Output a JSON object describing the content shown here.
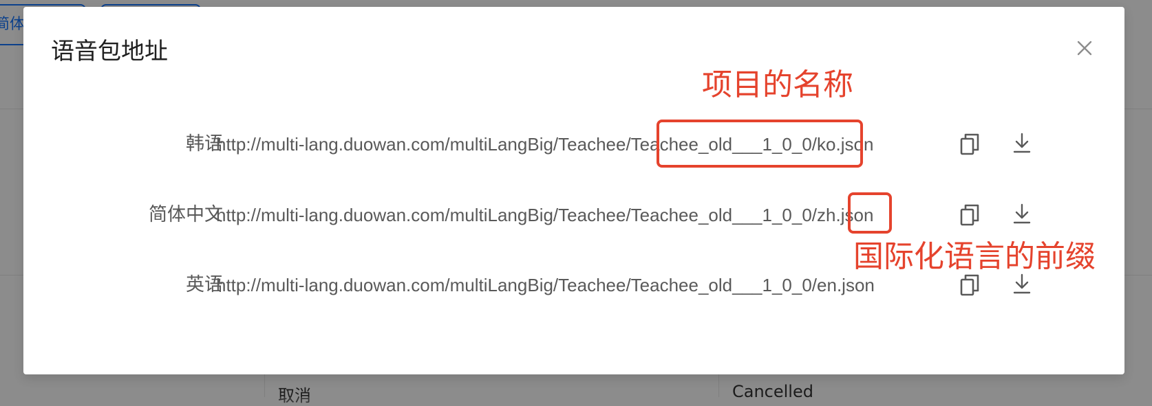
{
  "background": {
    "button_1_label": "简体",
    "table_cell_left": "取消",
    "table_cell_right": "Cancelled"
  },
  "modal": {
    "title": "语音包地址",
    "close_icon": "close-icon",
    "rows": [
      {
        "label": "韩语",
        "url": "http://multi-lang.duowan.com/multiLangBig/Teachee/Teachee_old___1_0_0/ko.json",
        "copy_icon": "copy-icon",
        "download_icon": "download-icon"
      },
      {
        "label": "简体中文",
        "url": "http://multi-lang.duowan.com/multiLangBig/Teachee/Teachee_old___1_0_0/zh.json",
        "copy_icon": "copy-icon",
        "download_icon": "download-icon"
      },
      {
        "label": "英语",
        "url": "http://multi-lang.duowan.com/multiLangBig/Teachee/Teachee_old___1_0_0/en.json",
        "copy_icon": "copy-icon",
        "download_icon": "download-icon"
      }
    ]
  },
  "annotations": {
    "project_name_note": "项目的名称",
    "prefix_note": "国际化语言的前缀",
    "color": "#e5432d"
  }
}
